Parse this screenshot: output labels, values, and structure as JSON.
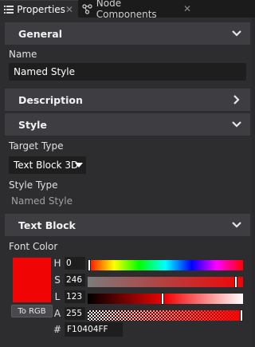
{
  "tabs": [
    {
      "label": "Properties",
      "icon": "list-icon",
      "active": true
    },
    {
      "label": "Node Components",
      "icon": "nodes-icon",
      "active": false
    }
  ],
  "sections": {
    "general": {
      "label": "General",
      "expanded": true
    },
    "description": {
      "label": "Description",
      "expanded": false
    },
    "style": {
      "label": "Style",
      "expanded": true
    },
    "text_block": {
      "label": "Text Block",
      "expanded": true
    }
  },
  "general": {
    "name_label": "Name",
    "name_value": "Named Style"
  },
  "style": {
    "target_type_label": "Target Type",
    "target_type_value": "Text Block 3D",
    "style_type_label": "Style Type",
    "style_type_value": "Named Style"
  },
  "text_block": {
    "font_color_label": "Font Color",
    "color_hex": "#F10404",
    "to_rgb_label": "To RGB",
    "channels": [
      {
        "label": "H",
        "value": "0",
        "fraction": 0.0
      },
      {
        "label": "S",
        "value": "246",
        "fraction": 0.965
      },
      {
        "label": "L",
        "value": "123",
        "fraction": 0.482
      },
      {
        "label": "A",
        "value": "255",
        "fraction": 1.0
      }
    ],
    "hex_label": "#",
    "hex_value": "F10404FF"
  },
  "colors": {
    "background": "#2d2d30",
    "section_header": "#3e3e42",
    "field": "#1e1e1e",
    "accent_color": "#F10404"
  }
}
